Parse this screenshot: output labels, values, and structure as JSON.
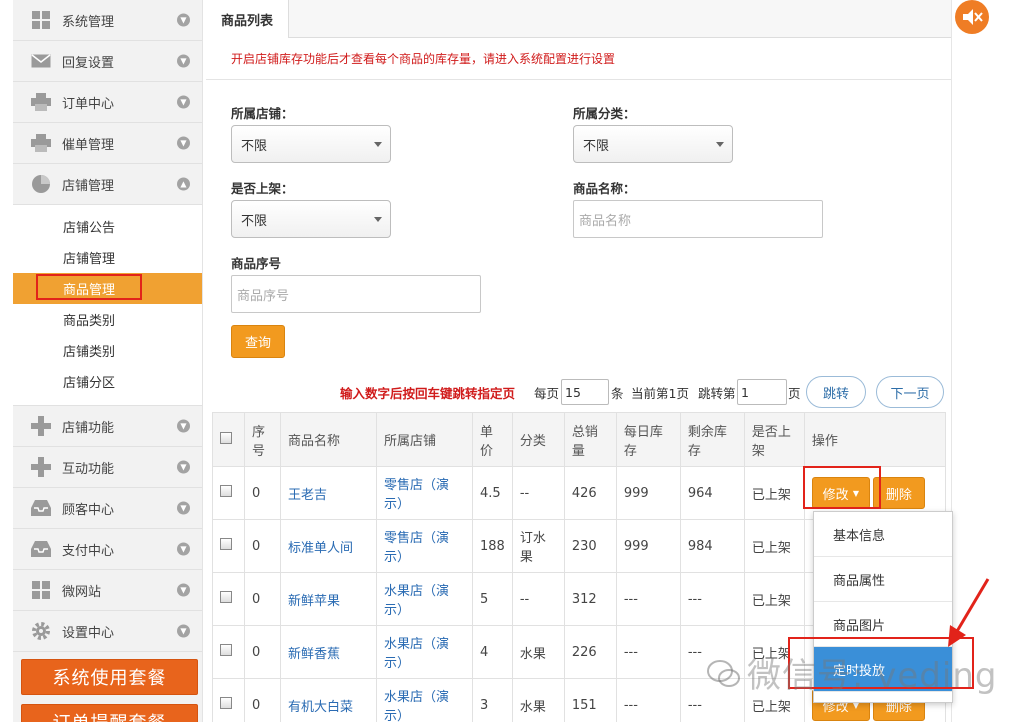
{
  "sidebar": {
    "items_top": [
      {
        "label": "系统管理",
        "icon": "grid-icon"
      },
      {
        "label": "回复设置",
        "icon": "envelope-icon"
      },
      {
        "label": "订单中心",
        "icon": "printer-icon"
      },
      {
        "label": "催单管理",
        "icon": "printer-icon"
      },
      {
        "label": "店铺管理",
        "icon": "pie-chart-icon"
      }
    ],
    "sub_items": [
      "店铺公告",
      "店铺管理",
      "商品管理",
      "商品类别",
      "店铺类别",
      "店铺分区"
    ],
    "active_sub": "商品管理",
    "items_bottom": [
      {
        "label": "店铺功能",
        "icon": "plus-icon"
      },
      {
        "label": "互动功能",
        "icon": "plus-icon"
      },
      {
        "label": "顾客中心",
        "icon": "inbox-icon"
      },
      {
        "label": "支付中心",
        "icon": "inbox-icon"
      },
      {
        "label": "微网站",
        "icon": "grid-icon"
      },
      {
        "label": "设置中心",
        "icon": "gear-icon"
      }
    ],
    "big_buttons": [
      "系统使用套餐",
      "订单提醒套餐"
    ]
  },
  "tab": {
    "label": "商品列表"
  },
  "notice": "开启店铺库存功能后才查看每个商品的库存量，请进入系统配置进行设置",
  "filters": {
    "shop_label": "所属店铺：",
    "shop_value": "不限",
    "category_label": "所属分类：",
    "category_value": "不限",
    "onshelf_label": "是否上架：",
    "onshelf_value": "不限",
    "name_label": "商品名称：",
    "name_placeholder": "商品名称",
    "sku_label": "商品序号",
    "sku_placeholder": "商品序号",
    "query_button": "查询"
  },
  "pager": {
    "hint": "输入数字后按回车键跳转指定页",
    "per_page_prefix": "每页",
    "per_page": "15",
    "per_page_suffix": "条",
    "current": "当前第1页",
    "jump_prefix": "跳转第",
    "jump_value": "1",
    "jump_suffix": "页",
    "jump_button": "跳转",
    "next_button": "下一页"
  },
  "table": {
    "headers": [
      "序号",
      "商品名称",
      "所属店铺",
      "单价",
      "分类",
      "总销量",
      "每日库存",
      "剩余库存",
      "是否上架",
      "操作"
    ],
    "rows": [
      {
        "no": "0",
        "name": "王老吉",
        "shop": "零售店（演示）",
        "price": "4.5",
        "category": "--",
        "sales": "426",
        "daily": "999",
        "remain": "964",
        "onshelf": "已上架"
      },
      {
        "no": "0",
        "name": "标准单人间",
        "shop": "零售店（演示）",
        "price": "188",
        "category": "订水果",
        "sales": "230",
        "daily": "999",
        "remain": "984",
        "onshelf": "已上架"
      },
      {
        "no": "0",
        "name": "新鲜苹果",
        "shop": "水果店（演示）",
        "price": "5",
        "category": "--",
        "sales": "312",
        "daily": "---",
        "remain": "---",
        "onshelf": "已上架"
      },
      {
        "no": "0",
        "name": "新鲜香蕉",
        "shop": "水果店（演示）",
        "price": "4",
        "category": "水果",
        "sales": "226",
        "daily": "---",
        "remain": "---",
        "onshelf": "已上架"
      },
      {
        "no": "0",
        "name": "有机大白菜",
        "shop": "水果店（演示）",
        "price": "3",
        "category": "水果",
        "sales": "151",
        "daily": "---",
        "remain": "---",
        "onshelf": "已上架"
      }
    ],
    "edit_button": "修改",
    "delete_button": "删除"
  },
  "dropdown": {
    "items": [
      "基本信息",
      "商品属性",
      "商品图片",
      "定时投放"
    ]
  },
  "watermark": "微信号: veding",
  "colors": {
    "accent": "#f0a132",
    "highlight": "#e2231a",
    "link": "#2a6bb3",
    "notice": "#d01b1b"
  }
}
